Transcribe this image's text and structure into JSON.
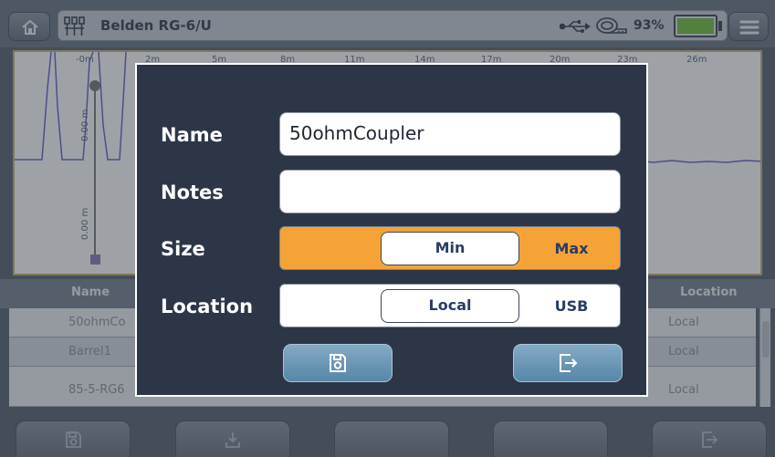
{
  "header": {
    "cable_name": "Belden RG-6/U",
    "battery_percent": "93%",
    "icons": [
      "home-icon",
      "cable-icon",
      "usb-icon",
      "tape-measure-icon",
      "battery-icon",
      "menu-icon"
    ]
  },
  "trace": {
    "ticks": [
      "-0m",
      "2m",
      "5m",
      "8m",
      "11m",
      "14m",
      "17m",
      "20m",
      "23m",
      "26m"
    ],
    "cursor_top_label": "0.00 m",
    "cursor_bottom_label": "0.00 m"
  },
  "table": {
    "headers": [
      "Name",
      "Location"
    ],
    "rows": [
      {
        "name": "50ohmCo",
        "location": "Local"
      },
      {
        "name": "Barrel1",
        "location": "Local"
      },
      {
        "name": "85-5-RG6",
        "location": "Local"
      }
    ]
  },
  "bottom_toolbar": {
    "icons": [
      "save-icon",
      "download-icon",
      "",
      "",
      "exit-icon"
    ]
  },
  "dialog": {
    "name_label": "Name",
    "name_value": "50ohmCoupler",
    "notes_label": "Notes",
    "notes_value": "",
    "size_label": "Size",
    "size_options": [
      "Min",
      "Max"
    ],
    "size_selected": "Min",
    "location_label": "Location",
    "location_options": [
      "Local",
      "USB"
    ],
    "location_selected": "Local"
  },
  "colors": {
    "accent_orange": "#f5a337",
    "dialog_bg": "#2c3647",
    "trace_color": "#6b66c9",
    "button_blue": "#5686a8"
  }
}
